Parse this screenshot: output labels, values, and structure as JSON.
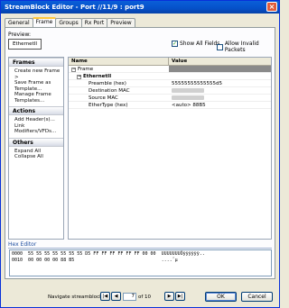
{
  "window": {
    "title": "StreamBlock Editor - Port //11/9 : port9",
    "close_glyph": "×"
  },
  "tabs": [
    "General",
    "Frame",
    "Groups",
    "Rx Port",
    "Preview"
  ],
  "active_tab": "Frame",
  "preview": {
    "label": "Preview:",
    "value": "EthernetII"
  },
  "options": {
    "show_all_fields": {
      "label": "Show All Fields",
      "checked": true
    },
    "allow_invalid_packets": {
      "label": "Allow Invalid Packets",
      "checked": false
    }
  },
  "sidebar": {
    "frames": {
      "title": "Frames",
      "items": [
        "Create new Frame >",
        "Save Frame as",
        "Template...",
        "Manage Frame",
        "Templates..."
      ]
    },
    "actions": {
      "title": "Actions",
      "items": [
        "Add Header(s)...",
        "Link Modifiers/VFDs..."
      ]
    },
    "others": {
      "title": "Others",
      "items": [
        "Expand All",
        "Collapse All"
      ]
    }
  },
  "grid": {
    "columns": {
      "name": "Name",
      "value": "Value"
    },
    "rows": [
      {
        "name": "Frame",
        "value": ""
      },
      {
        "name": "EthernetII",
        "value": ""
      },
      {
        "name": "Preamble (hex)",
        "value": "55555555555555d5"
      },
      {
        "name": "Destination MAC",
        "value": ""
      },
      {
        "name": "Source MAC",
        "value": ""
      },
      {
        "name": "EtherType (hex)",
        "value": "<auto> 88B5"
      }
    ]
  },
  "hex_editor": {
    "title": "Hex Editor",
    "lines": [
      "0000  55 55 55 55 55 55 55 D5 FF FF FF FF FF FF 00 00  UUUUUUUÕÿÿÿÿÿÿ..",
      "0010  00 00 00 00 88 B5                                ....ˆµ"
    ]
  },
  "navigation": {
    "label": "Navigate streamblocks:",
    "current_page": "7",
    "of_label": "of 10",
    "first": "|◀",
    "prev": "◀",
    "next": "▶",
    "last": "▶|"
  },
  "buttons": {
    "ok": "OK",
    "cancel": "Cancel"
  }
}
